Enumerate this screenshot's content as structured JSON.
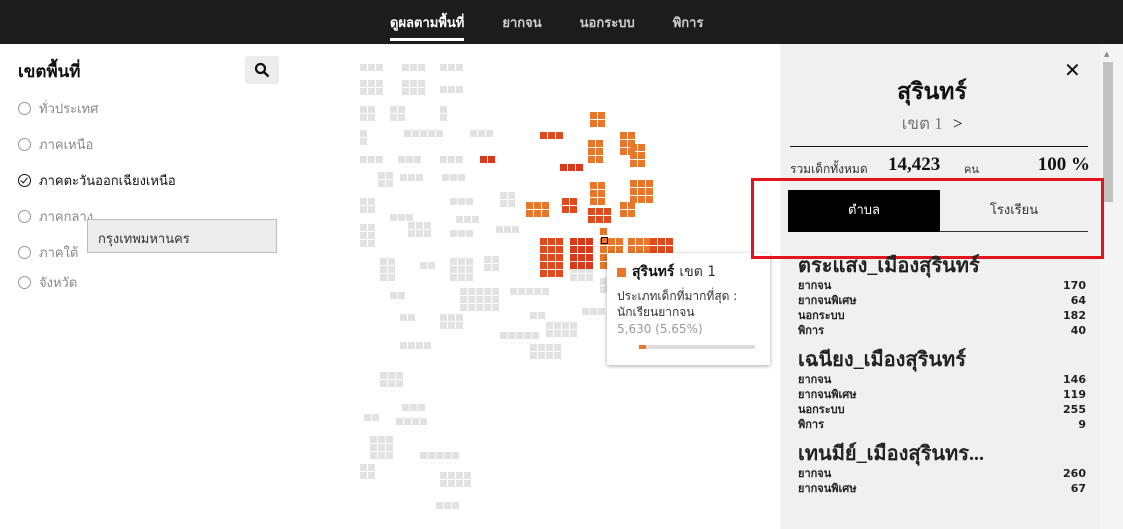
{
  "topnav": {
    "tabs": [
      {
        "label": "ดูผลตามพื้นที่",
        "active": true
      },
      {
        "label": "ยากจน",
        "active": false
      },
      {
        "label": "นอกระบบ",
        "active": false
      },
      {
        "label": "พิการ",
        "active": false
      }
    ]
  },
  "sidebar": {
    "title": "เขตพื้นที่",
    "search_icon": "search-icon",
    "options": [
      {
        "label": "ทั่วประเทศ",
        "checked": false
      },
      {
        "label": "ภาคเหนือ",
        "checked": false
      },
      {
        "label": "ภาคตะวันออกเฉียงเหนือ",
        "checked": true
      },
      {
        "label": "ภาคกลาง",
        "checked": false
      },
      {
        "label": "ภาคใต้",
        "checked": false
      },
      {
        "label": "จังหวัด",
        "checked": false
      }
    ],
    "province_value": "กรุงเทพมหานคร"
  },
  "tooltip": {
    "name": "สุรินทร์",
    "district": "เขต 1",
    "label": "ประเภทเด็กที่มากที่สุด : นักเรียนยากจน",
    "value": "5,630 (5.65%)",
    "fill_fraction": 0.0565,
    "accent": "#e8772b"
  },
  "panel": {
    "province": "สุรินทร์",
    "district": "เขต 1",
    "chevron": ">",
    "total_label": "รวมเด็กทั้งหมด",
    "total_value": "14,423",
    "total_unit": "คน",
    "total_percent": "100 %",
    "tab_active": "ตำบล",
    "tab_inactive": "โรงเรียน",
    "highlight_color": "#e2141f",
    "entries": [
      {
        "name": "ตระแสง_เมืองสุรินทร์",
        "rows": [
          {
            "label": "ยากจน",
            "value": "170"
          },
          {
            "label": "ยากจนพิเศษ",
            "value": "64"
          },
          {
            "label": "นอกระบบ",
            "value": "182"
          },
          {
            "label": "พิการ",
            "value": "40"
          }
        ]
      },
      {
        "name": "เฉนียง_เมืองสุรินทร์",
        "rows": [
          {
            "label": "ยากจน",
            "value": "146"
          },
          {
            "label": "ยากจนพิเศษ",
            "value": "119"
          },
          {
            "label": "นอกระบบ",
            "value": "255"
          },
          {
            "label": "พิการ",
            "value": "9"
          }
        ]
      },
      {
        "name": "เทนมีย์_เมืองสุรินทร...",
        "rows": [
          {
            "label": "ยากจน",
            "value": "260"
          },
          {
            "label": "ยากจนพิเศษ",
            "value": "67"
          }
        ]
      }
    ]
  }
}
